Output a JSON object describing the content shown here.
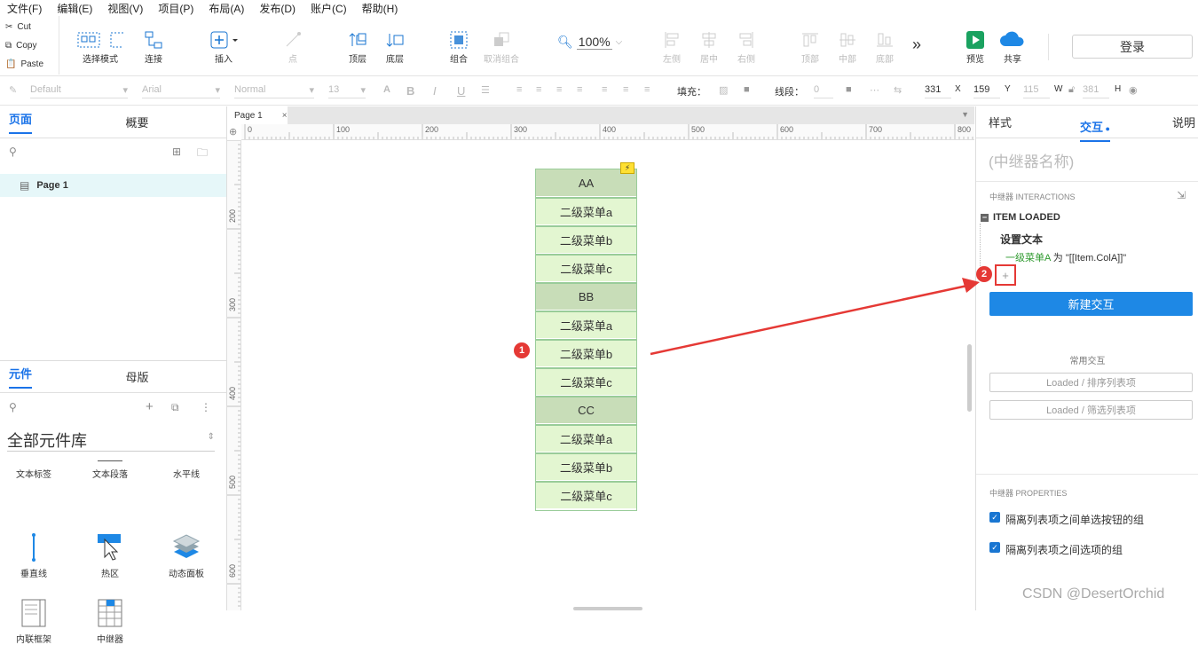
{
  "menu": [
    "文件(F)",
    "编辑(E)",
    "视图(V)",
    "项目(P)",
    "布局(A)",
    "发布(D)",
    "账户(C)",
    "帮助(H)"
  ],
  "clipboard": {
    "cut": "Cut",
    "copy": "Copy",
    "paste": "Paste"
  },
  "toolbar": {
    "select_mode": "选择模式",
    "connect": "连接",
    "insert": "插入",
    "point": "点",
    "front": "顶层",
    "back": "底层",
    "group": "组合",
    "ungroup": "取消组合",
    "zoom": "100%",
    "align_left": "左侧",
    "align_center": "居中",
    "align_right": "右侧",
    "align_top": "顶部",
    "align_middle": "中部",
    "align_bottom": "底部",
    "more": "»",
    "preview": "预览",
    "share": "共享",
    "login": "登录"
  },
  "stylebar": {
    "style": "Default",
    "font": "Arial",
    "weight": "Normal",
    "size": "13",
    "fill_label": "填充：",
    "line_label": "线段：",
    "line_value": "0",
    "x": "331",
    "x_label": "X",
    "y": "159",
    "y_label": "Y",
    "w": "115",
    "w_label": "W",
    "h": "381",
    "h_label": "H"
  },
  "left": {
    "tab_pages": "页面",
    "tab_outline": "概要",
    "page_item": "Page 1",
    "tab_widgets": "元件",
    "tab_masters": "母版",
    "library": "全部元件库",
    "widgets": [
      "文本标签",
      "文本段落",
      "水平线",
      "垂直线",
      "热区",
      "动态面板",
      "内联框架",
      "中继器"
    ]
  },
  "canvas": {
    "doc_tab": "Page 1",
    "ruler_h": [
      "0",
      "100",
      "200",
      "300",
      "400",
      "500",
      "600",
      "700",
      "800"
    ],
    "ruler_v": [
      "200",
      "300",
      "400",
      "500",
      "600"
    ],
    "rows": [
      {
        "text": "AA",
        "kind": "h"
      },
      {
        "text": "二级菜单a",
        "kind": "s"
      },
      {
        "text": "二级菜单b",
        "kind": "s"
      },
      {
        "text": "二级菜单c",
        "kind": "s"
      },
      {
        "text": "BB",
        "kind": "h"
      },
      {
        "text": "二级菜单a",
        "kind": "s"
      },
      {
        "text": "二级菜单b",
        "kind": "s"
      },
      {
        "text": "二级菜单c",
        "kind": "s"
      },
      {
        "text": "CC",
        "kind": "h"
      },
      {
        "text": "二级菜单a",
        "kind": "s"
      },
      {
        "text": "二级菜单b",
        "kind": "s"
      },
      {
        "text": "二级菜单c",
        "kind": "s"
      }
    ],
    "badge1": "1"
  },
  "right": {
    "tab_style": "样式",
    "tab_interact": "交互",
    "tab_notes": "说明",
    "name_placeholder": "(中继器名称)",
    "interactions_title": "中继器 INTERACTIONS",
    "event": "ITEM LOADED",
    "action": "设置文本",
    "target": "一级菜单A",
    "target_mid": " 为 ",
    "target_value": "\"[[Item.ColA]]\"",
    "add": "+",
    "badge2": "2",
    "new_btn": "新建交互",
    "common": "常用交互",
    "common1": "Loaded / 排序列表项",
    "common2": "Loaded / 筛选列表项",
    "props_title": "中继器 PROPERTIES",
    "prop1": "隔离列表项之间单选按钮的组",
    "prop2": "隔离列表项之间选项的组",
    "watermark": "CSDN @DesertOrchid"
  },
  "colors": {
    "accent": "#1a73e8",
    "button": "#1e88e5",
    "badge": "#e53935",
    "arrow": "#e53935"
  }
}
